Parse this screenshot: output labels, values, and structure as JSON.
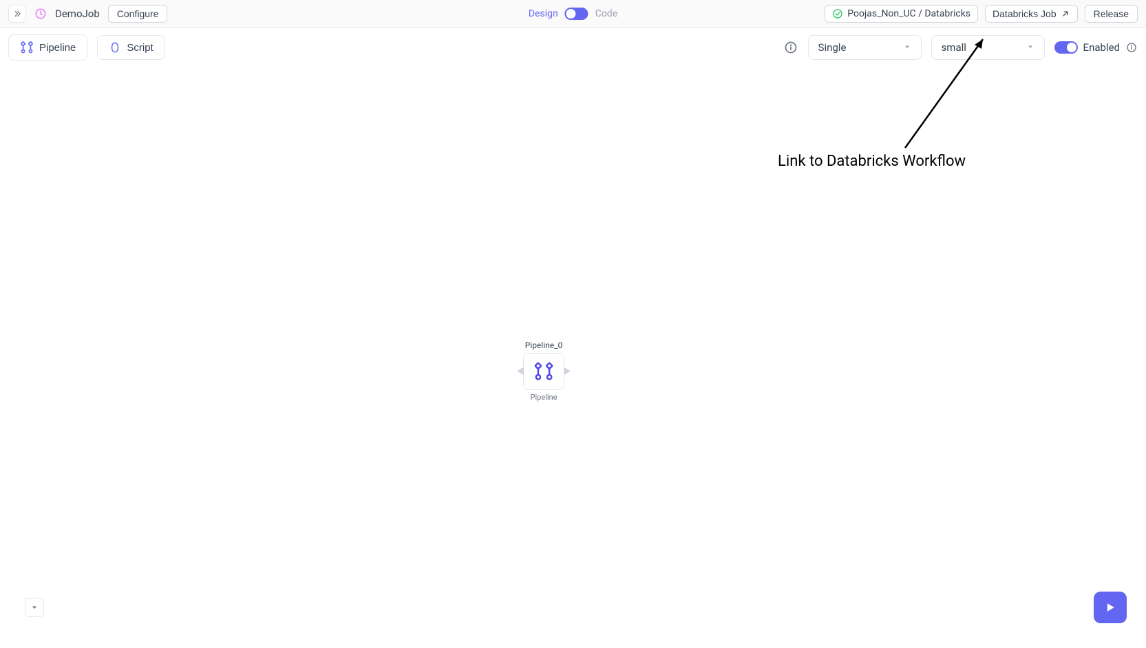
{
  "header": {
    "job_name": "DemoJob",
    "configure_label": "Configure",
    "design_label": "Design",
    "code_label": "Code",
    "fabric_label": "Poojas_Non_UC / Databricks",
    "databricks_job_label": "Databricks Job",
    "release_label": "Release"
  },
  "toolbar": {
    "pipeline_label": "Pipeline",
    "script_label": "Script",
    "select1_value": "Single",
    "select2_value": "small",
    "enabled_label": "Enabled"
  },
  "node": {
    "title": "Pipeline_0",
    "subtitle": "Pipeline"
  },
  "annotation": {
    "text": "Link to Databricks Workflow"
  }
}
